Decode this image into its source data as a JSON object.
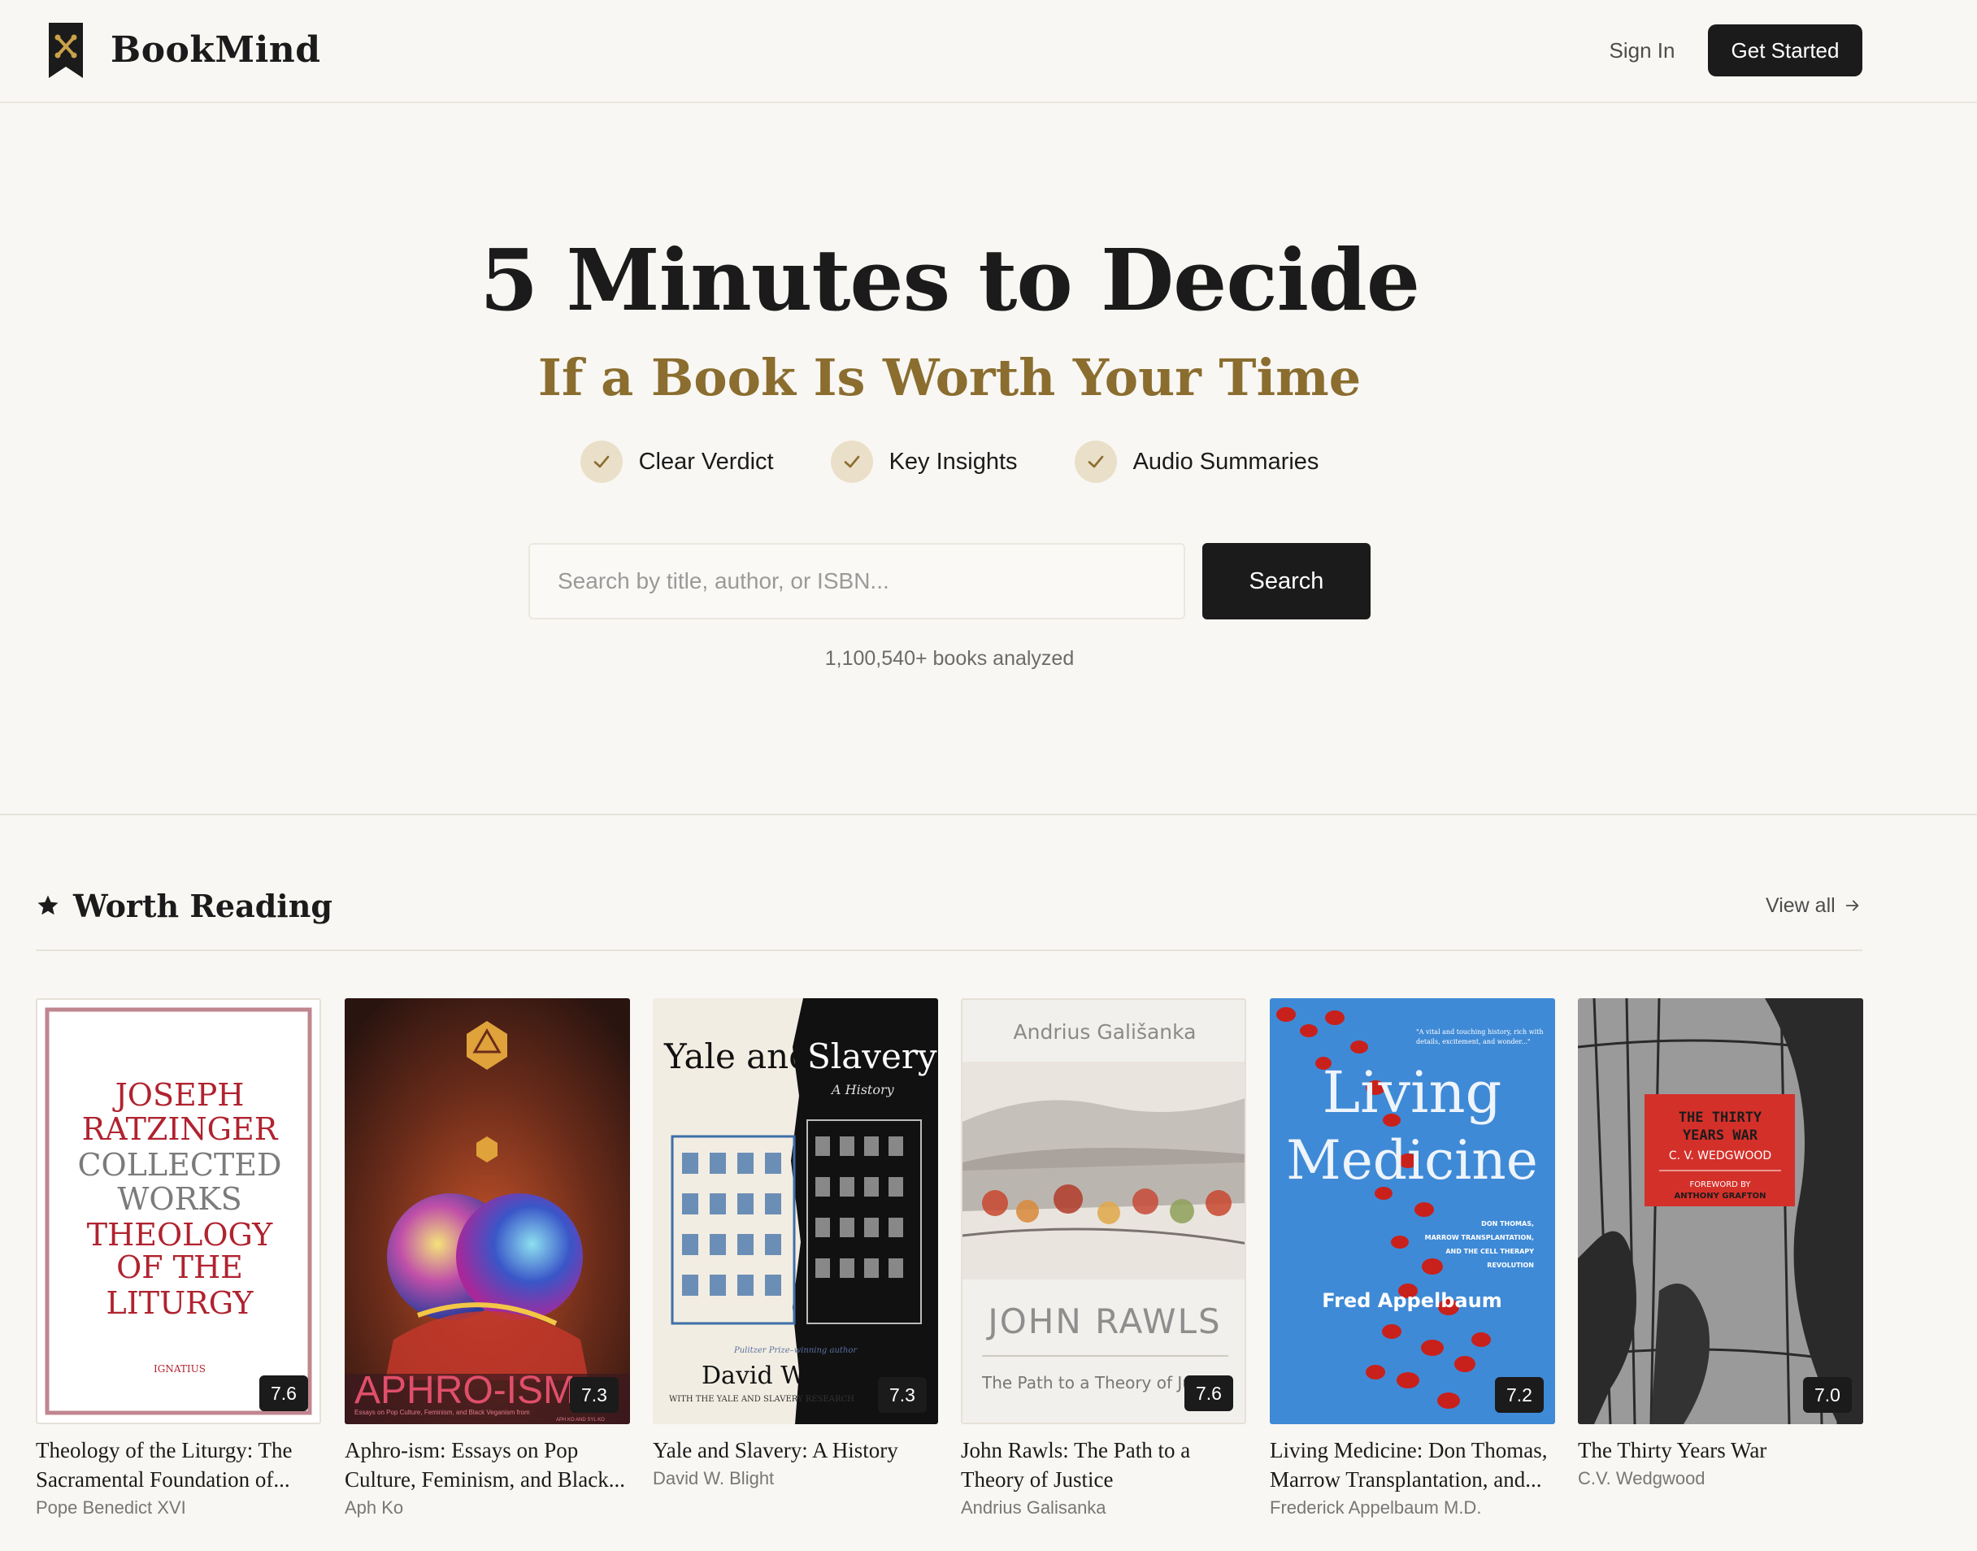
{
  "header": {
    "brand": "BookMind",
    "logo_icon": "bookmark-logo-icon",
    "sign_in": "Sign In",
    "get_started": "Get Started"
  },
  "hero": {
    "title": "5 Minutes to Decide",
    "subtitle": "If a Book Is Worth Your Time",
    "features": [
      "Clear Verdict",
      "Key Insights",
      "Audio Summaries"
    ],
    "search": {
      "placeholder": "Search by title, author, or ISBN...",
      "value": "",
      "button": "Search"
    },
    "books_count": "1,100,540+ books analyzed"
  },
  "section": {
    "title": "Worth Reading",
    "view_all": "View all",
    "books": [
      {
        "title": "Theology of the Liturgy: The Sacramental Foundation of...",
        "author": "Pope Benedict XVI",
        "score": "7.6",
        "cover_text": [
          "JOSEPH",
          "RATZINGER",
          "COLLECTED",
          "WORKS",
          "THEOLOGY",
          "OF THE",
          "LITURGY",
          "IGNATIUS"
        ]
      },
      {
        "title": "Aphro-ism: Essays on Pop Culture, Feminism, and Black...",
        "author": "Aph Ko",
        "score": "7.3",
        "cover_text": [
          "APHRO-ISM",
          "Essays on Pop Culture, Feminism, and Black Veganism from",
          "APH KO AND SYL KO"
        ]
      },
      {
        "title": "Yale and Slavery: A History",
        "author": "David W. Blight",
        "score": "7.3",
        "cover_text": [
          "Yale and",
          "Slavery",
          "A History",
          "Pulitzer Prize–winning author",
          "David W. Blight",
          "WITH THE YALE AND SLAVERY RESEARCH"
        ]
      },
      {
        "title": "John Rawls: The Path to a Theory of Justice",
        "author": "Andrius Galisanka",
        "score": "7.6",
        "cover_text": [
          "Andrius Gališanka",
          "JOHN RAWLS",
          "The Path to a Theory of Ju"
        ]
      },
      {
        "title": "Living Medicine: Don Thomas, Marrow Transplantation, and...",
        "author": "Frederick Appelbaum M.D.",
        "score": "7.2",
        "cover_text": [
          "Living",
          "Medicine",
          "DON THOMAS,",
          "MARROW TRANSPLANTATION,",
          "AND THE CELL THERAPY",
          "REVOLUTION",
          "Fred Appelbaum"
        ]
      },
      {
        "title": "The Thirty Years War",
        "author": "C.V. Wedgwood",
        "score": "7.0",
        "cover_text": [
          "THE THIRTY",
          "YEARS WAR",
          "C. V. WEDGWOOD",
          "FOREWORD BY",
          "ANTHONY GRAFTON"
        ]
      }
    ]
  },
  "colors": {
    "background": "#f9f7f3",
    "dark": "#1b1b1b",
    "gold_accent": "#8a6d2f",
    "check_bg": "#eadfc8"
  }
}
